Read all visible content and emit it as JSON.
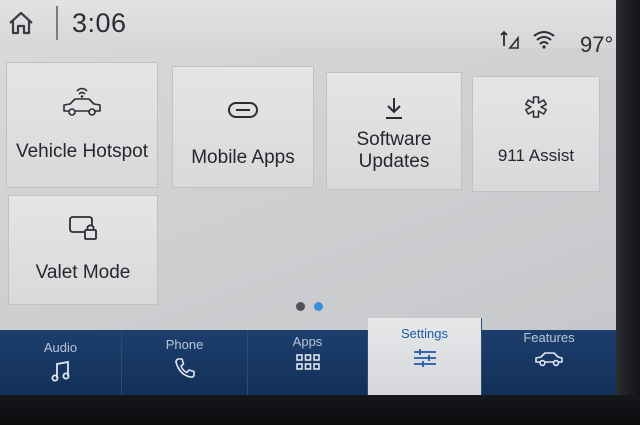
{
  "status": {
    "time": "3:06",
    "temperature": "97°"
  },
  "tiles": [
    {
      "label": "Vehicle Hotspot",
      "icon": "vehicle-hotspot-icon"
    },
    {
      "label": "Mobile Apps",
      "icon": "link-icon"
    },
    {
      "label": "Software\nUpdates",
      "icon": "download-icon"
    },
    {
      "label": "911 Assist",
      "icon": "medical-star-icon"
    },
    {
      "label": "Valet Mode",
      "icon": "valet-lock-icon"
    }
  ],
  "pagination": {
    "pages": 2,
    "current": 2
  },
  "nav": [
    {
      "label": "Audio",
      "icon": "music-note-icon"
    },
    {
      "label": "Phone",
      "icon": "phone-icon"
    },
    {
      "label": "Apps",
      "icon": "apps-grid-icon"
    },
    {
      "label": "Settings",
      "icon": "sliders-icon",
      "active": true
    },
    {
      "label": "Features",
      "icon": "car-icon"
    }
  ],
  "colors": {
    "nav_background": "#123058",
    "active_accent": "#1f5aa8",
    "dot_active": "#3a8fd8",
    "dot_inactive": "#505257"
  }
}
